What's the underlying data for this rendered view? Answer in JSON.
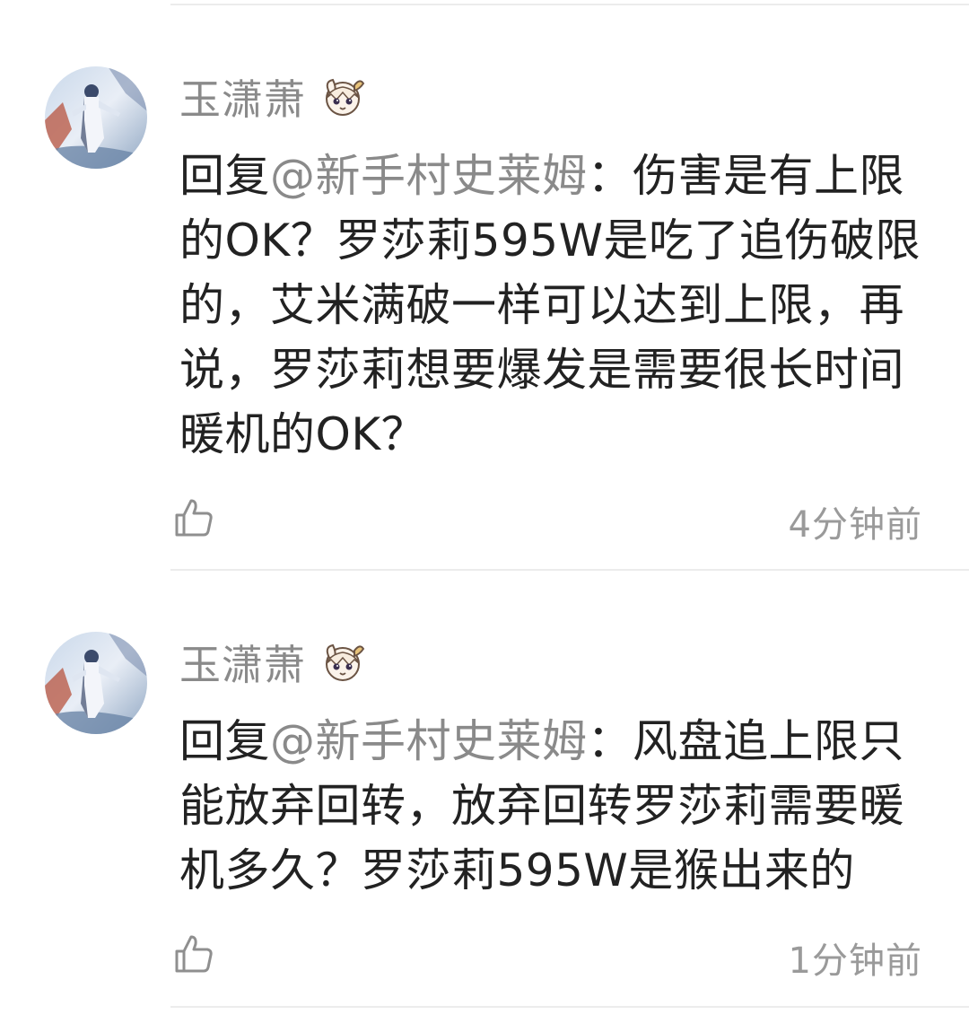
{
  "comments": [
    {
      "username": "玉潇萧",
      "reply_prefix": "回复",
      "mention": "@新手村史莱姆",
      "text": "：伤害是有上限的OK？罗莎莉595W是吃了追伤破限的，艾米满破一样可以达到上限，再说，罗莎莉想要爆发是需要很长时间暖机的OK？",
      "time": "4分钟前",
      "like_icon": "thumbs-up-icon",
      "avatar_icon": "avatar",
      "badge_icon": "paimon-badge-icon"
    },
    {
      "username": "玉潇萧",
      "reply_prefix": "回复",
      "mention": "@新手村史莱姆",
      "text": "：风盘追上限只能放弃回转，放弃回转罗莎莉需要暖机多久？罗莎莉595W是猴出来的",
      "time": "1分钟前",
      "like_icon": "thumbs-up-icon",
      "avatar_icon": "avatar",
      "badge_icon": "paimon-badge-icon"
    }
  ],
  "colors": {
    "username": "#8a8a8a",
    "text": "#222222",
    "mention": "#8a8a8a",
    "time": "#9a9a9a",
    "divider": "#ececec"
  }
}
